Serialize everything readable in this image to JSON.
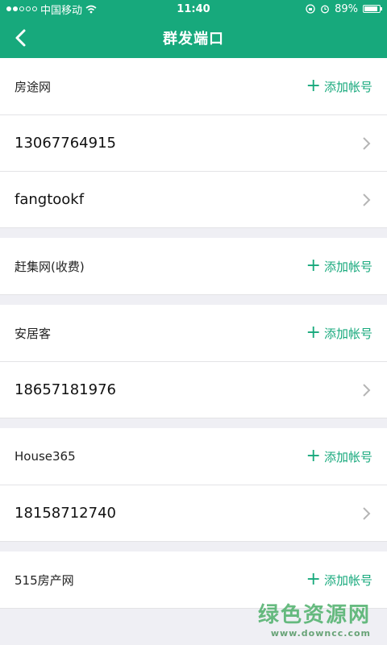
{
  "status": {
    "carrier": "中国移动",
    "time": "11:40",
    "battery": "89%"
  },
  "header": {
    "title": "群发端口"
  },
  "add_label": "添加帐号",
  "groups": [
    {
      "site": "房途网",
      "accounts": [
        "13067764915",
        "fangtookf"
      ]
    },
    {
      "site": "赶集网(收费)",
      "accounts": []
    },
    {
      "site": "安居客",
      "accounts": [
        "18657181976"
      ]
    },
    {
      "site": "House365",
      "accounts": [
        "18158712740"
      ]
    },
    {
      "site": "515房产网",
      "accounts": []
    }
  ],
  "watermark": {
    "main": "绿色资源网",
    "sub": "www.downcc.com"
  },
  "colors": {
    "primary": "#17a97c",
    "background": "#efeff4"
  }
}
